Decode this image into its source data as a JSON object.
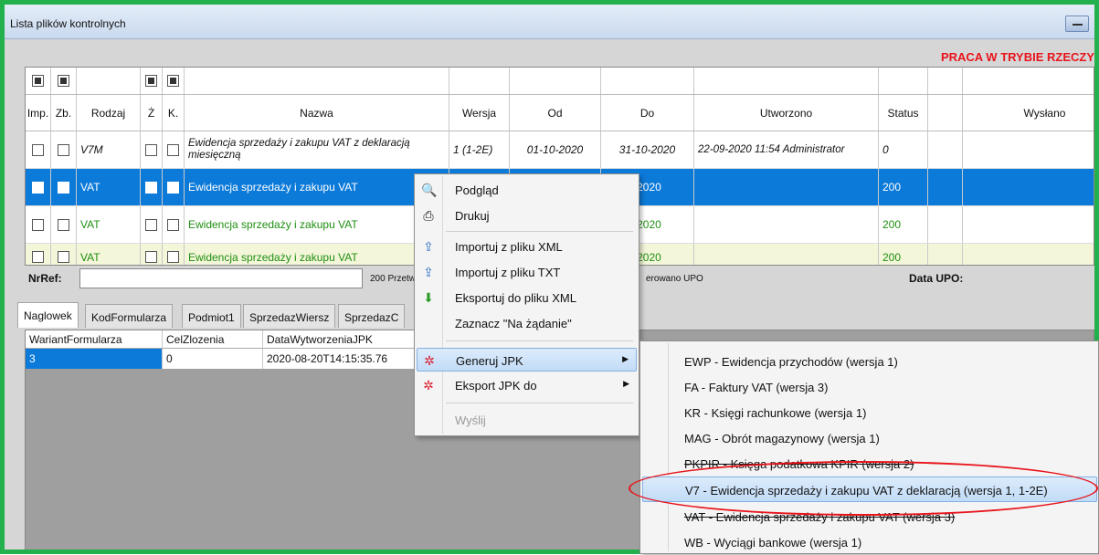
{
  "window": {
    "title": "Lista plików kontrolnych"
  },
  "warning": "PRACA W TRYBIE RZECZY",
  "grid": {
    "headers": [
      "Imp.",
      "Zb.",
      "Rodzaj",
      "Ż",
      "K.",
      "Nazwa",
      "Wersja",
      "Od",
      "Do",
      "Utworzono",
      "Status",
      "",
      "Wysłano"
    ],
    "rows": [
      {
        "rodzaj": "V7M",
        "nazwa": "Ewidencja sprzedaży i zakupu VAT z deklaracją miesięczną",
        "wersja": "1 (1-2E)",
        "od": "01-10-2020",
        "do": "31-10-2020",
        "utworzono": "22-09-2020 11:54 Administrator",
        "status": "0"
      },
      {
        "rodzaj": "VAT",
        "nazwa": "Ewidencja sprzedaży i zakupu VAT",
        "do": "-2020",
        "status": "200"
      },
      {
        "rodzaj": "VAT",
        "nazwa": "Ewidencja sprzedaży i zakupu VAT",
        "do": "-2020",
        "status": "200"
      },
      {
        "rodzaj": "VAT",
        "nazwa": "Ewidencja sprzedaży i zakupu VAT",
        "do": "-2020",
        "status": "200"
      }
    ]
  },
  "nrref": {
    "label": "NrRef:",
    "value": "",
    "przetw": "200 Przetwar",
    "upo": "erowano UPO",
    "data_upo": "Data UPO:"
  },
  "tabs": [
    "Naglowek",
    "KodFormularza",
    "Podmiot1",
    "SprzedazWiersz",
    "SprzedazC"
  ],
  "subgrid": {
    "headers": [
      "WariantFormularza",
      "CelZlozenia",
      "DataWytworzeniaJPK"
    ],
    "row": [
      "3",
      "0",
      "2020-08-20T14:15:35.76"
    ]
  },
  "context_menu": {
    "items": [
      {
        "label": "Podgląd",
        "icon": "preview-icon"
      },
      {
        "label": "Drukuj",
        "icon": "printer-icon"
      },
      {
        "label": "Importuj z pliku XML",
        "icon": "import-icon"
      },
      {
        "label": "Importuj z pliku TXT",
        "icon": "import-icon"
      },
      {
        "label": "Eksportuj do pliku XML",
        "icon": "export-icon"
      },
      {
        "label": "Zaznacz \"Na żądanie\"",
        "icon": ""
      },
      {
        "label": "Generuj JPK",
        "icon": "generate-icon"
      },
      {
        "label": "Eksport JPK do",
        "icon": "generate-icon"
      },
      {
        "label": "Wyślij",
        "icon": ""
      }
    ]
  },
  "submenu": {
    "items": [
      "EWP - Ewidencja przychodów (wersja 1)",
      "FA - Faktury VAT (wersja 3)",
      "KR - Księgi rachunkowe (wersja 1)",
      "MAG - Obrót magazynowy (wersja 1)",
      "PKPIR - Księga podatkowa KPIR (wersja 2)",
      "V7 - Ewidencja sprzedaży i zakupu VAT z deklaracją (wersja 1, 1-2E)",
      "VAT - Ewidencja sprzedaży i zakupu VAT (wersja 3)",
      "WB - Wyciągi bankowe (wersja 1)"
    ]
  },
  "colors": {
    "frame": "#22b14c",
    "selection": "#0c7ad9",
    "warning": "#e8141b",
    "green_text": "#1f8f12"
  }
}
